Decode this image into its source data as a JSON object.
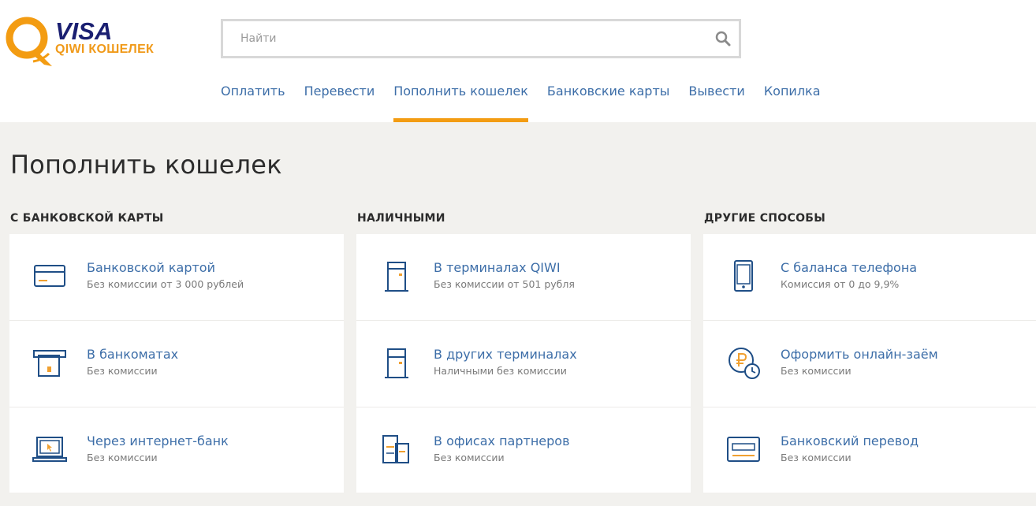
{
  "logo": {
    "brand_top": "VISA",
    "brand_bottom": "QIWI КОШЕЛЕК"
  },
  "search": {
    "placeholder": "Найти"
  },
  "nav": {
    "items": [
      "Оплатить",
      "Перевести",
      "Пополнить кошелек",
      "Банковские карты",
      "Вывести",
      "Копилка"
    ],
    "active": "Пополнить кошелек"
  },
  "page": {
    "title": "Пополнить кошелек"
  },
  "columns": [
    {
      "title": "С БАНКОВСКОЙ КАРТЫ",
      "rows": [
        {
          "icon": "bank-card-icon",
          "title": "Банковской картой",
          "sub": "Без комиссии от 3 000 рублей"
        },
        {
          "icon": "atm-icon",
          "title": "В банкоматах",
          "sub": "Без комиссии"
        },
        {
          "icon": "laptop-icon",
          "title": "Через интернет-банк",
          "sub": "Без комиссии"
        }
      ]
    },
    {
      "title": "НАЛИЧНЫМИ",
      "rows": [
        {
          "icon": "qiwi-terminal-icon",
          "title": "В терминалах QIWI",
          "sub": "Без комиссии от 501 рубля"
        },
        {
          "icon": "terminal-icon",
          "title": "В других терминалах",
          "sub": "Наличными без комиссии"
        },
        {
          "icon": "office-building-icon",
          "title": "В офисах партнеров",
          "sub": "Без комиссии"
        }
      ]
    },
    {
      "title": "ДРУГИЕ СПОСОБЫ",
      "rows": [
        {
          "icon": "phone-icon",
          "title": "С баланса телефона",
          "sub": "Комиссия от 0 до 9,9%"
        },
        {
          "icon": "loan-ruble-clock-icon",
          "title": "Оформить онлайн-заём",
          "sub": "Без комиссии"
        },
        {
          "icon": "bank-transfer-icon",
          "title": "Банковский перевод",
          "sub": "Без комиссии"
        }
      ]
    }
  ],
  "colors": {
    "accent": "#f39c12",
    "link": "#3d6ea8",
    "icon_stroke": "#1f4e86",
    "icon_accent": "#f0a030",
    "page_bg": "#f2f1ee"
  }
}
